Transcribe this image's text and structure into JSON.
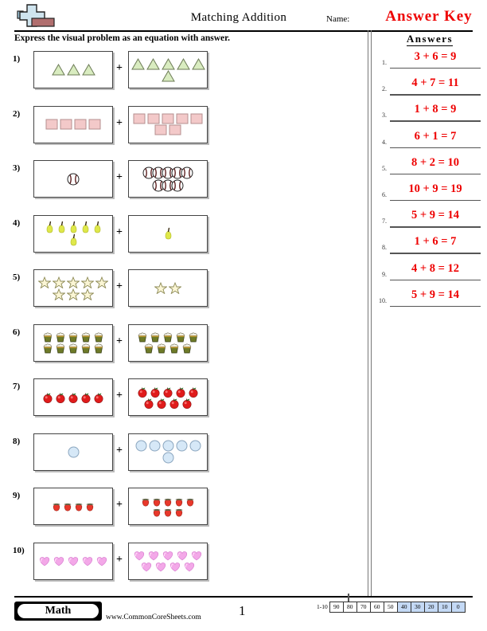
{
  "header": {
    "logo_icon": "plus-block-logo",
    "title": "Matching Addition",
    "name_label": "Name:",
    "answer_key_label": "Answer Key",
    "instructions": "Express the visual problem as an equation with answer."
  },
  "answers_panel": {
    "heading": "Answers",
    "items": [
      {
        "num": "1.",
        "value": "3 + 6 = 9"
      },
      {
        "num": "2.",
        "value": "4 + 7 = 11"
      },
      {
        "num": "3.",
        "value": "1 + 8 = 9"
      },
      {
        "num": "4.",
        "value": "6 + 1 = 7"
      },
      {
        "num": "5.",
        "value": "8 + 2 = 10"
      },
      {
        "num": "6.",
        "value": "10 + 9 = 19"
      },
      {
        "num": "7.",
        "value": "5 + 9 = 14"
      },
      {
        "num": "8.",
        "value": "1 + 6 = 7"
      },
      {
        "num": "9.",
        "value": "4 + 8 = 12"
      },
      {
        "num": "10.",
        "value": "5 + 9 = 14"
      }
    ]
  },
  "problems": [
    {
      "num": "1)",
      "icon": "triangle",
      "plus": "+",
      "left_count": 3,
      "right_count": 6
    },
    {
      "num": "2)",
      "icon": "square",
      "plus": "+",
      "left_count": 4,
      "right_count": 7
    },
    {
      "num": "3)",
      "icon": "baseball",
      "plus": "+",
      "left_count": 1,
      "right_count": 8
    },
    {
      "num": "4)",
      "icon": "pear",
      "plus": "+",
      "left_count": 6,
      "right_count": 1
    },
    {
      "num": "5)",
      "icon": "star",
      "plus": "+",
      "left_count": 8,
      "right_count": 2
    },
    {
      "num": "6)",
      "icon": "cupcake",
      "plus": "+",
      "left_count": 10,
      "right_count": 9
    },
    {
      "num": "7)",
      "icon": "apple",
      "plus": "+",
      "left_count": 5,
      "right_count": 9
    },
    {
      "num": "8)",
      "icon": "circle",
      "plus": "+",
      "left_count": 1,
      "right_count": 6
    },
    {
      "num": "9)",
      "icon": "strawberry",
      "plus": "+",
      "left_count": 4,
      "right_count": 8
    },
    {
      "num": "10)",
      "icon": "heart",
      "plus": "+",
      "left_count": 5,
      "right_count": 9
    }
  ],
  "footer": {
    "subject_badge": "Math",
    "site_url": "www.CommonCoreSheets.com",
    "page_number": "1",
    "scale_range": "1-10",
    "scale_cells": [
      {
        "label": "90",
        "highlighted": false
      },
      {
        "label": "80",
        "highlighted": false
      },
      {
        "label": "70",
        "highlighted": false
      },
      {
        "label": "60",
        "highlighted": false
      },
      {
        "label": "50",
        "highlighted": false
      },
      {
        "label": "40",
        "highlighted": true
      },
      {
        "label": "30",
        "highlighted": true
      },
      {
        "label": "20",
        "highlighted": true
      },
      {
        "label": "10",
        "highlighted": true
      },
      {
        "label": "0",
        "highlighted": true
      }
    ]
  },
  "colors": {
    "answer_red": "#ee0000",
    "triangle": "#d9ecc0",
    "square": "#f3c9c9",
    "pear": "#dfe84a",
    "star": "#fbf6d5",
    "cupcake": "#6d7a28",
    "apple": "#e01b1b",
    "circle": "#d6e8f7",
    "strawberry": "#e8382b",
    "heart": "#f3a8e8",
    "scale_highlight": "#c4d9f5"
  }
}
